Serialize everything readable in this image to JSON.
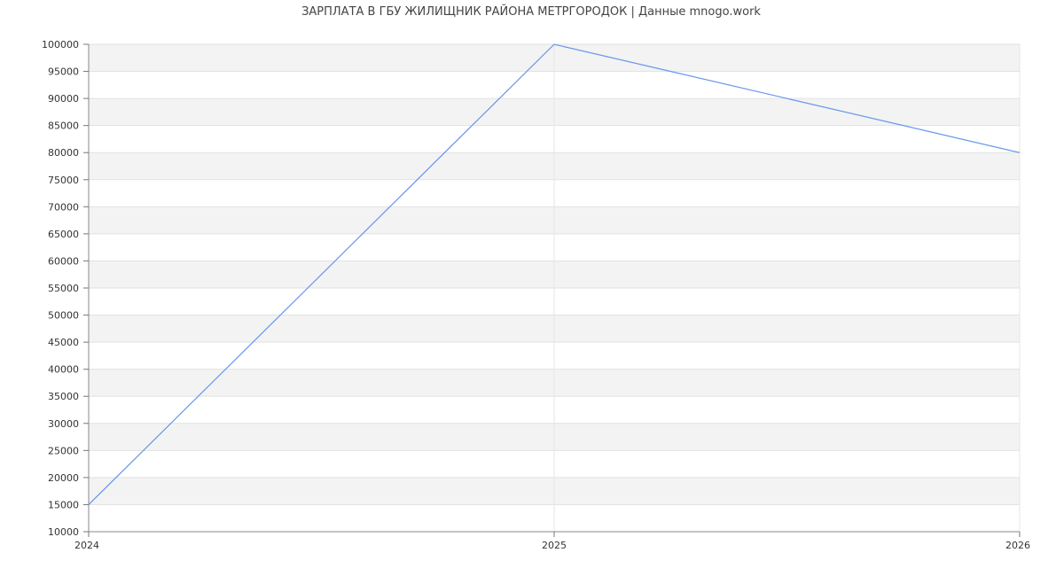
{
  "chart_data": {
    "type": "line",
    "title": "ЗАРПЛАТА В ГБУ ЖИЛИЩНИК РАЙОНА МЕТРГОРОДОК | Данные mnogo.work",
    "xlabel": "",
    "ylabel": "",
    "x": [
      "2024",
      "2025",
      "2026"
    ],
    "series": [
      {
        "values": [
          15000,
          100000,
          80000
        ]
      }
    ],
    "ylim": [
      10000,
      100000
    ],
    "ytick_step": 5000,
    "grid": true,
    "band_colors": [
      "#f3f3f3",
      "#ffffff"
    ],
    "line_color": "#6495ed"
  }
}
